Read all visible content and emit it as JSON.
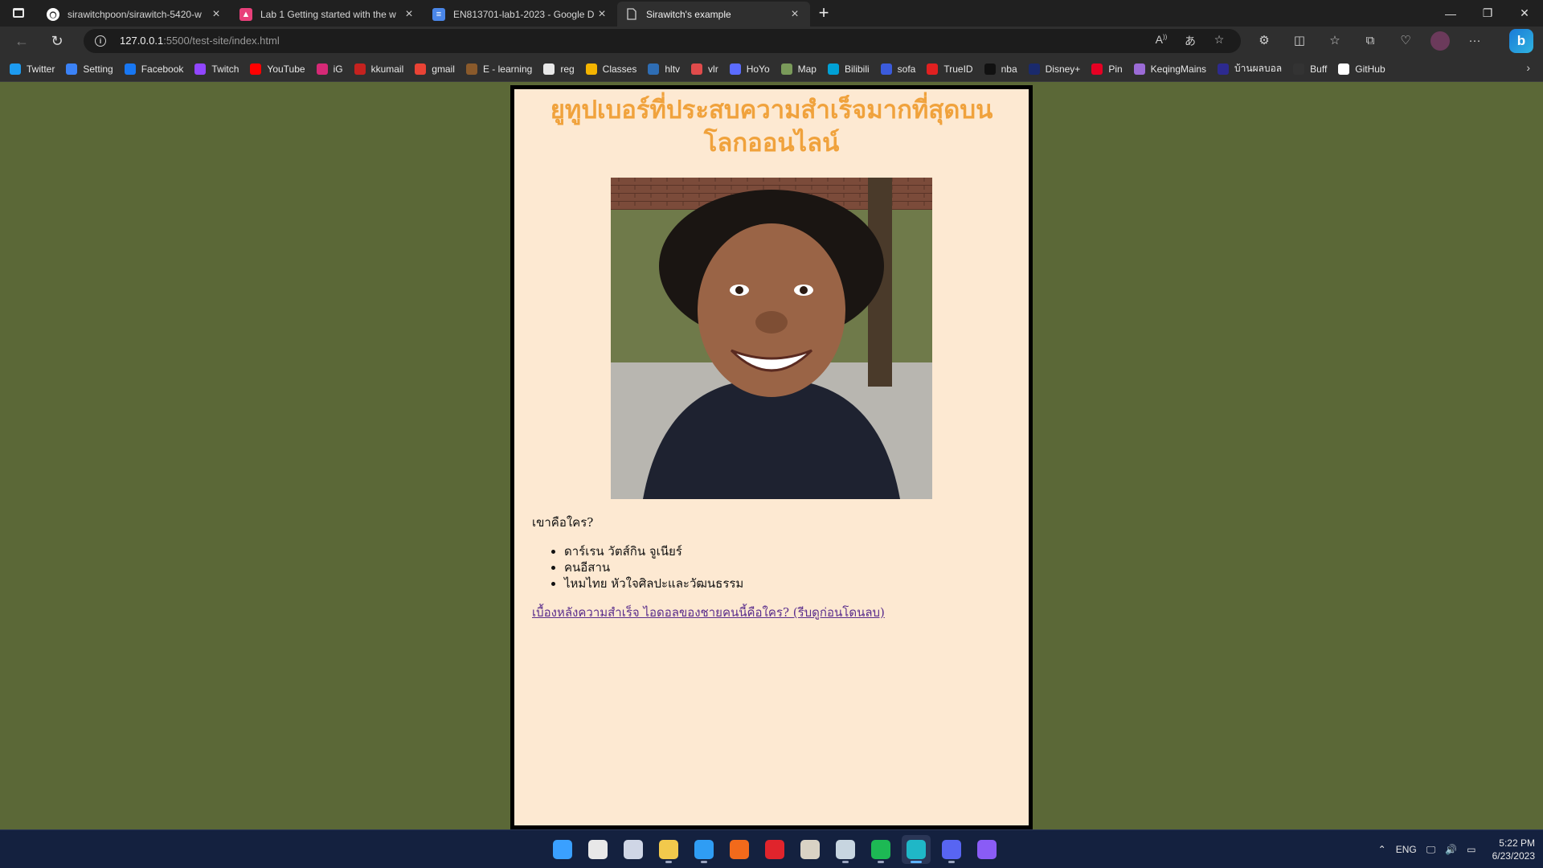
{
  "tabs": [
    {
      "title": "sirawitchpoon/sirawitch-5420-w",
      "icon": "github-icon",
      "color": "#ffffff"
    },
    {
      "title": "Lab 1 Getting started with the w",
      "icon": "mdn-icon",
      "color": "#e8407a"
    },
    {
      "title": "EN813701-lab1-2023 - Google D",
      "icon": "google-docs-icon",
      "color": "#4a86e8"
    },
    {
      "title": "Sirawitch's example",
      "icon": "page-icon",
      "color": "#cccccc"
    }
  ],
  "address_bar": {
    "host": "127.0.0.1",
    "path": ":5500/test-site/index.html"
  },
  "bookmarks": [
    {
      "label": "Twitter",
      "icon": "twitter-icon",
      "color": "#1d9bf0"
    },
    {
      "label": "Setting",
      "icon": "gear-icon",
      "color": "#3b82f6"
    },
    {
      "label": "Facebook",
      "icon": "facebook-icon",
      "color": "#1877f2"
    },
    {
      "label": "Twitch",
      "icon": "twitch-icon",
      "color": "#9146ff"
    },
    {
      "label": "YouTube",
      "icon": "youtube-icon",
      "color": "#ff0000"
    },
    {
      "label": "iG",
      "icon": "instagram-icon",
      "color": "#d62976"
    },
    {
      "label": "kkumail",
      "icon": "gmail-icon",
      "color": "#c5221f"
    },
    {
      "label": "gmail",
      "icon": "gmail-icon",
      "color": "#ea4335"
    },
    {
      "label": "E - learning",
      "icon": "elearning-icon",
      "color": "#8a5a2b"
    },
    {
      "label": "reg",
      "icon": "reg-icon",
      "color": "#e8e8e8"
    },
    {
      "label": "Classes",
      "icon": "classroom-icon",
      "color": "#f4b400"
    },
    {
      "label": "hltv",
      "icon": "hltv-icon",
      "color": "#2e6db4"
    },
    {
      "label": "vlr",
      "icon": "vlr-icon",
      "color": "#e04b4b"
    },
    {
      "label": "HoYo",
      "icon": "hoyo-icon",
      "color": "#5b6cff"
    },
    {
      "label": "Map",
      "icon": "map-icon",
      "color": "#7a9a5a"
    },
    {
      "label": "Bilibili",
      "icon": "bilibili-icon",
      "color": "#00a1d6"
    },
    {
      "label": "sofa",
      "icon": "sofa-icon",
      "color": "#3b5bdb"
    },
    {
      "label": "TrueID",
      "icon": "trueid-icon",
      "color": "#e02020"
    },
    {
      "label": "nba",
      "icon": "sn-icon",
      "color": "#111111"
    },
    {
      "label": "Disney+",
      "icon": "disney-icon",
      "color": "#1a2a6c"
    },
    {
      "label": "Pin",
      "icon": "pinterest-icon",
      "color": "#e60023"
    },
    {
      "label": "KeqingMains",
      "icon": "keqing-icon",
      "color": "#9b6bd6"
    },
    {
      "label": "บ้านผลบอล",
      "icon": "thai-flag-icon",
      "color": "#2d2a8f"
    },
    {
      "label": "Buff",
      "icon": "buff-icon",
      "color": "#333333"
    },
    {
      "label": "GitHub",
      "icon": "github-icon",
      "color": "#ffffff"
    }
  ],
  "page": {
    "title": "ยูทูปเบอร์ที่ประสบความสำเร็จมากที่สุดบนโลกออนไลน์",
    "section_label": "เขาคือใคร?",
    "list": [
      "ดาร์เรน วัตส์กิน จูเนียร์",
      "คนอีสาน",
      "ไหมไทย หัวใจศิลปะและวัฒนธรรม"
    ],
    "link_text": "เบื้องหลังความสำเร็จ ไอดอลของชายคนนี้คือใคร? (รีบดูก่อนโดนลบ)",
    "background_color": "#5b6837",
    "card_color": "#fde9d2",
    "title_color": "#f0a23c"
  },
  "taskbar": {
    "apps": [
      {
        "name": "start",
        "icon": "windows-icon",
        "color": "#3aa0ff"
      },
      {
        "name": "search",
        "icon": "search-icon",
        "color": "#e8e8e8"
      },
      {
        "name": "task-view",
        "icon": "task-view-icon",
        "color": "#cfd6e6"
      },
      {
        "name": "file-explorer",
        "icon": "folder-icon",
        "color": "#f2c94c"
      },
      {
        "name": "vscode",
        "icon": "vscode-icon",
        "color": "#2f9df4"
      },
      {
        "name": "app-orange",
        "icon": "orange-app-icon",
        "color": "#f26a1b"
      },
      {
        "name": "app-red",
        "icon": "red-app-icon",
        "color": "#e0242c"
      },
      {
        "name": "app-photo",
        "icon": "photo-app-icon",
        "color": "#d9d2c4"
      },
      {
        "name": "steam",
        "icon": "steam-icon",
        "color": "#c7d5e0"
      },
      {
        "name": "spotify",
        "icon": "spotify-icon",
        "color": "#1db954"
      },
      {
        "name": "edge",
        "icon": "edge-icon",
        "color": "#1fb7c7"
      },
      {
        "name": "discord",
        "icon": "discord-icon",
        "color": "#5865f2"
      },
      {
        "name": "github-desktop",
        "icon": "github-desktop-icon",
        "color": "#8a5cf6"
      }
    ],
    "tray_lang": "ENG",
    "time": "5:22 PM",
    "date": "6/23/2023"
  }
}
